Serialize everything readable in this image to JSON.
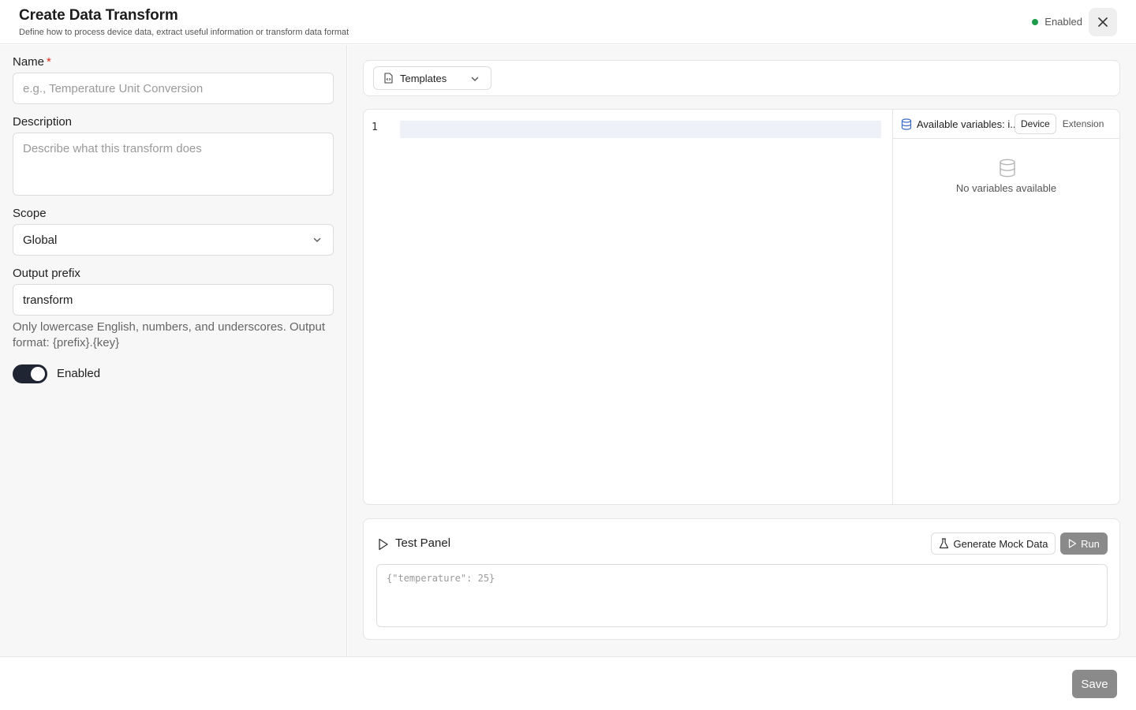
{
  "header": {
    "title": "Create Data Transform",
    "subtitle": "Define how to process device data, extract useful information or transform data format",
    "status_label": "Enabled",
    "status_color": "#1e9a4a",
    "close_icon": "close-icon"
  },
  "form": {
    "name_label": "Name",
    "name_required_mark": "*",
    "name_placeholder": "e.g., Temperature Unit Conversion",
    "description_label": "Description",
    "description_placeholder": "Describe what this transform does",
    "scope_label": "Scope",
    "scope_value": "Global",
    "output_prefix_label": "Output prefix",
    "output_prefix_value": "transform",
    "output_prefix_help": "Only lowercase English, numbers, and underscores. Output format: {prefix}.{key}",
    "enabled_label": "Enabled",
    "enabled": true
  },
  "editor": {
    "templates_label": "Templates",
    "line_number": "1",
    "variables_title": "Available variables: i...",
    "tabs": [
      "Device",
      "Extension"
    ],
    "active_tab": "Device",
    "empty_text": "No variables available"
  },
  "test_panel": {
    "title": "Test Panel",
    "mock_button": "Generate Mock Data",
    "run_button": "Run",
    "input_placeholder": "{\"temperature\": 25}"
  },
  "footer": {
    "save_label": "Save"
  }
}
